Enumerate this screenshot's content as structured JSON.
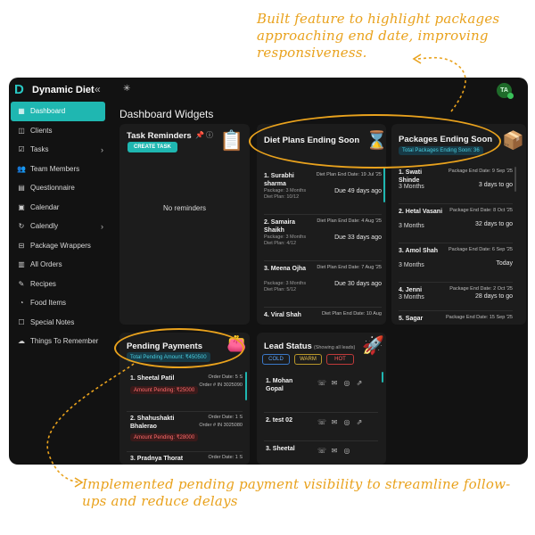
{
  "annotations": {
    "top": "Built feature to highlight packages approaching end date, improving responsiveness.",
    "bottom": "Implemented pending payment visibility to streamline follow-ups and reduce delays"
  },
  "brand": {
    "logo": "D",
    "name": "Dynamic Diet",
    "collapse": "«"
  },
  "nav": [
    {
      "label": "Dashboard",
      "icon": "▦",
      "active": true
    },
    {
      "label": "Clients",
      "icon": "◫"
    },
    {
      "label": "Tasks",
      "icon": "☑",
      "chevron": "›"
    },
    {
      "label": "Team Members",
      "icon": "👥"
    },
    {
      "label": "Questionnaire",
      "icon": "▤"
    },
    {
      "label": "Calendar",
      "icon": "▣"
    },
    {
      "label": "Calendly",
      "icon": "↻",
      "chevron": "›"
    },
    {
      "label": "Package Wrappers",
      "icon": "⊟"
    },
    {
      "label": "All Orders",
      "icon": "▥"
    },
    {
      "label": "Recipes",
      "icon": "✎"
    },
    {
      "label": "Food Items",
      "icon": "◔"
    },
    {
      "label": "Special Notes",
      "icon": "☐"
    },
    {
      "label": "Things To Remember",
      "icon": "☁"
    }
  ],
  "topbar": {
    "icon": "✳",
    "avatar": "TA"
  },
  "page_title": "Dashboard Widgets",
  "task": {
    "title": "Task Reminders",
    "pin": "📌",
    "info": "ⓘ",
    "create": "CREATE TASK",
    "empty": "No reminders",
    "icon": "📋"
  },
  "diet": {
    "title": "Diet Plans Ending Soon",
    "icon": "⌛",
    "items": [
      {
        "name": "1. Surabhi sharma",
        "sub": "Package: 3 Months Diet Plan: 10/12",
        "date": "Diet Plan End Date: 19 Jul '25",
        "due": "Due 49 days ago"
      },
      {
        "name": "2. Samaira Shaikh",
        "sub": "Package: 3 Months Diet Plan: 4/12",
        "date": "Diet Plan End Date: 4 Aug '25",
        "due": "Due 33 days ago"
      },
      {
        "name": "3. Meena Ojha",
        "sub": "Package: 3 Months Diet Plan: 5/12",
        "date": "Diet Plan End Date: 7 Aug '25",
        "due": "Due 30 days ago"
      },
      {
        "name": "4. Viral Shah",
        "sub": "",
        "date": "Diet Plan End Date: 10 Aug",
        "due": ""
      }
    ]
  },
  "packages": {
    "title": "Packages Ending Soon",
    "total": "Total Packages Ending Soon: 36",
    "icon": "📦",
    "items": [
      {
        "name": "1. Swati Shinde",
        "sub": "3 Months",
        "date": "Package End Date: 9 Sep '25",
        "due": "3 days to go"
      },
      {
        "name": "2. Hetal Vasani",
        "sub": "3 Months",
        "date": "Package End Date: 8 Oct '25",
        "due": "32 days to go"
      },
      {
        "name": "3. Amol Shah",
        "sub": "3 Months",
        "date": "Package End Date: 6 Sep '25",
        "due": "Today"
      },
      {
        "name": "4. Jenni",
        "sub": "3 Months",
        "date": "Package End Date: 2 Oct '25",
        "due": "28 days to go"
      },
      {
        "name": "5. Sagar",
        "sub": "",
        "date": "Package End Date: 15 Sep '25",
        "due": ""
      }
    ]
  },
  "pending": {
    "title": "Pending Payments",
    "total": "Total Pending Amount: ₹450500",
    "icon": "👛",
    "items": [
      {
        "name": "1. Sheetal Patil",
        "order_date": "Order Date: 5 S",
        "order_id": "Order # IN 3025090",
        "amount": "Amount Pending: ₹25000"
      },
      {
        "name": "2. Shahushakti Bhalerao",
        "order_date": "Order Date: 1 S",
        "order_id": "Order # IN 3025080",
        "amount": "Amount Pending: ₹28000"
      },
      {
        "name": "3. Pradnya Thorat",
        "order_date": "Order Date: 1 S",
        "order_id": "",
        "amount": ""
      }
    ]
  },
  "leads": {
    "title": "Lead Status",
    "note": "(Showing all leads)",
    "icon": "🚀",
    "chips": {
      "cold": "COLD",
      "warm": "WARM",
      "hot": "HOT"
    },
    "items": [
      {
        "name": "1. Mohan Gopal"
      },
      {
        "name": "2. test 02"
      },
      {
        "name": "3. Sheetal"
      }
    ],
    "actions": {
      "call": "☏",
      "mail": "✉",
      "whatsapp": "◎",
      "link": "⇗"
    }
  },
  "colors": {
    "accent": "#1fb7b1",
    "highlight": "#e9a21d",
    "background": "#121212",
    "card": "#1c1c1c"
  }
}
